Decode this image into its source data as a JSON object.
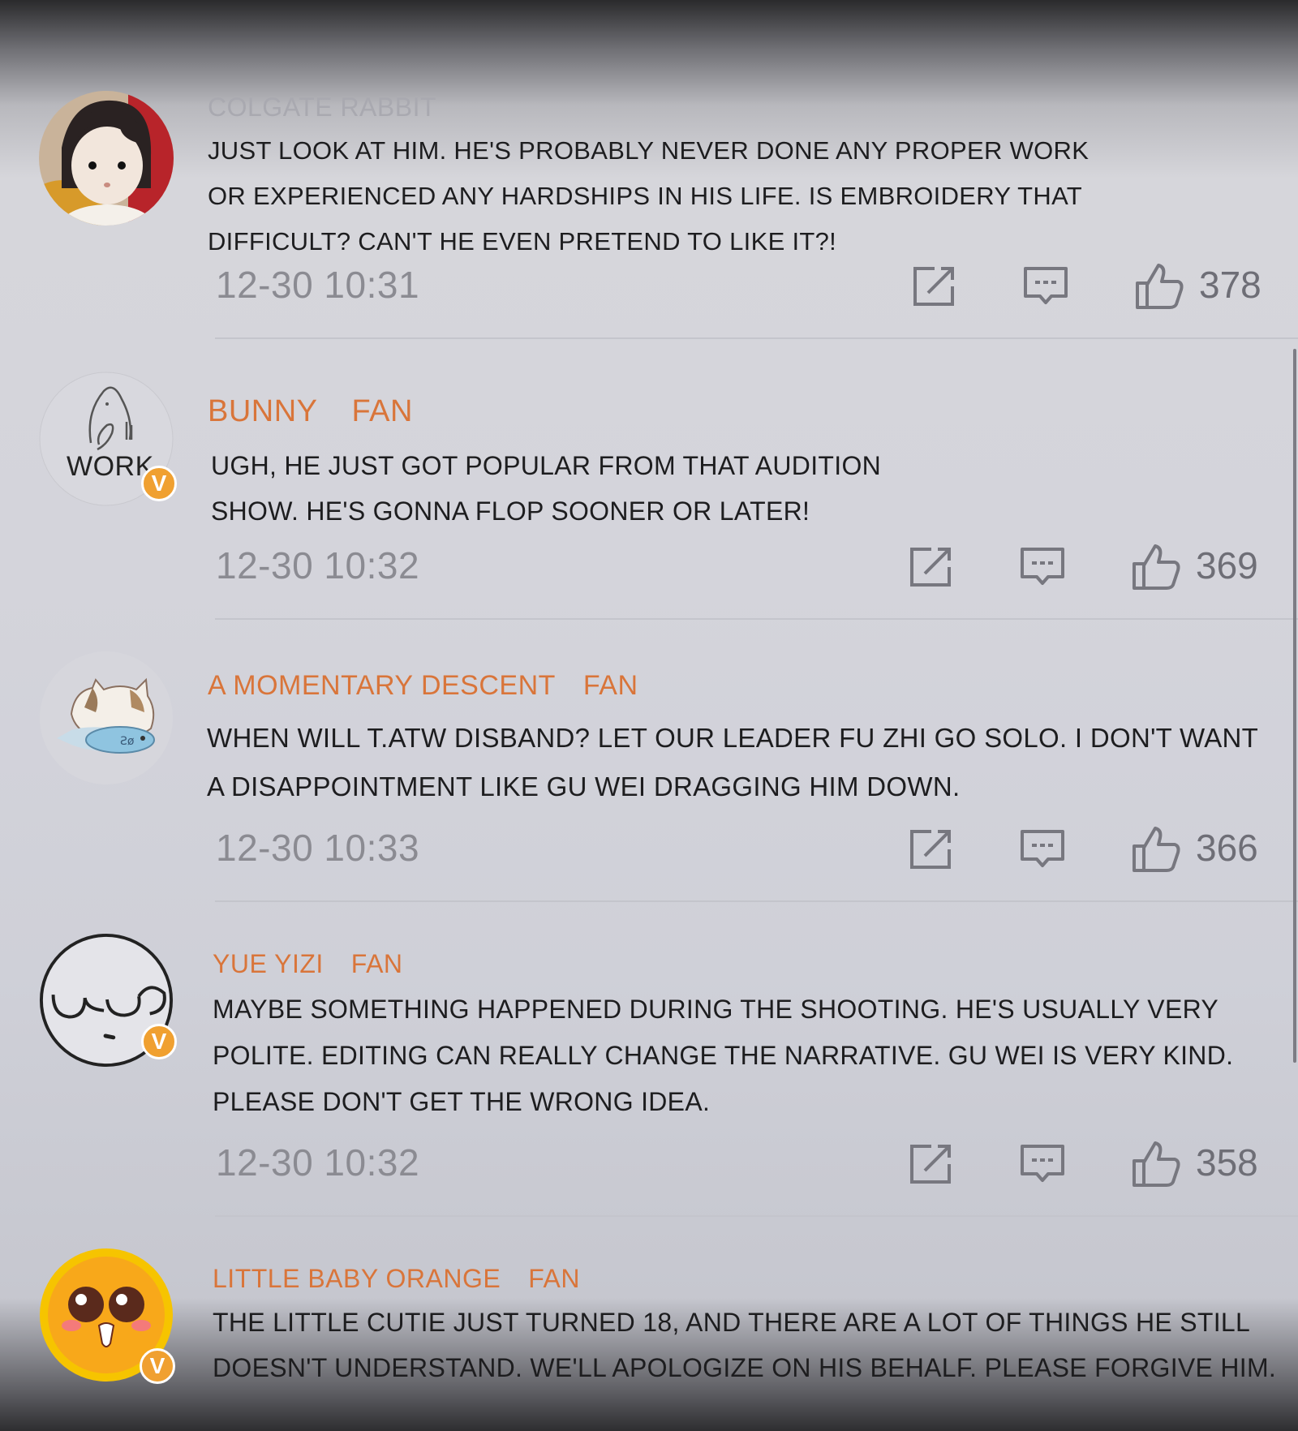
{
  "colors": {
    "username_gray": "#a9a9b0",
    "username_orange": "#d9753a",
    "body_text": "#1d1d1f",
    "meta_gray": "#8b8b92",
    "verified_badge": "#f0a030"
  },
  "comments": [
    {
      "username": "COLGATE RABBIT",
      "tag": "",
      "avatar_icon": "girl-avatar-icon",
      "avatar_caption": "",
      "verified": false,
      "text": "JUST LOOK AT HIM. HE'S PROBABLY NEVER DONE ANY PROPER WORK OR EXPERIENCED ANY HARDSHIPS IN HIS LIFE. IS EMBROIDERY THAT DIFFICULT? CAN'T HE EVEN PRETEND TO LIKE IT?!",
      "time": "12-30 10:31",
      "likes": "378"
    },
    {
      "username": "BUNNY",
      "tag": "FAN",
      "avatar_icon": "sketch-avatar-icon",
      "avatar_caption": "WORK",
      "verified": true,
      "text": "UGH, HE JUST GOT POPULAR FROM THAT AUDITION SHOW. HE'S GONNA FLOP SOONER OR LATER!",
      "time": "12-30 10:32",
      "likes": "369"
    },
    {
      "username": "A MOMENTARY DESCENT",
      "tag": "FAN",
      "avatar_icon": "cat-fish-avatar-icon",
      "avatar_caption": "",
      "verified": false,
      "text": "WHEN WILL T.ATW DISBAND? LET OUR LEADER FU ZHI GO SOLO. I DON'T WANT A DISAPPOINTMENT LIKE GU WEI DRAGGING HIM DOWN.",
      "time": "12-30 10:33",
      "likes": "366"
    },
    {
      "username": "YUE YIZI",
      "tag": "FAN",
      "avatar_icon": "doodle-face-avatar-icon",
      "avatar_caption": "",
      "verified": true,
      "text": "MAYBE SOMETHING HAPPENED DURING THE SHOOTING. HE'S USUALLY VERY POLITE. EDITING CAN REALLY CHANGE THE NARRATIVE. GU WEI IS VERY KIND. PLEASE DON'T GET THE WRONG IDEA.",
      "time": "12-30 10:32",
      "likes": "358"
    },
    {
      "username": "LITTLE BABY ORANGE",
      "tag": "FAN",
      "avatar_icon": "orange-face-avatar-icon",
      "avatar_caption": "",
      "verified": true,
      "text": "THE LITTLE CUTIE JUST TURNED 18, AND THERE ARE A LOT OF THINGS HE STILL DOESN'T UNDERSTAND. WE'LL APOLOGIZE ON HIS BEHALF. PLEASE FORGIVE HIM.",
      "time": "",
      "likes": ""
    }
  ]
}
